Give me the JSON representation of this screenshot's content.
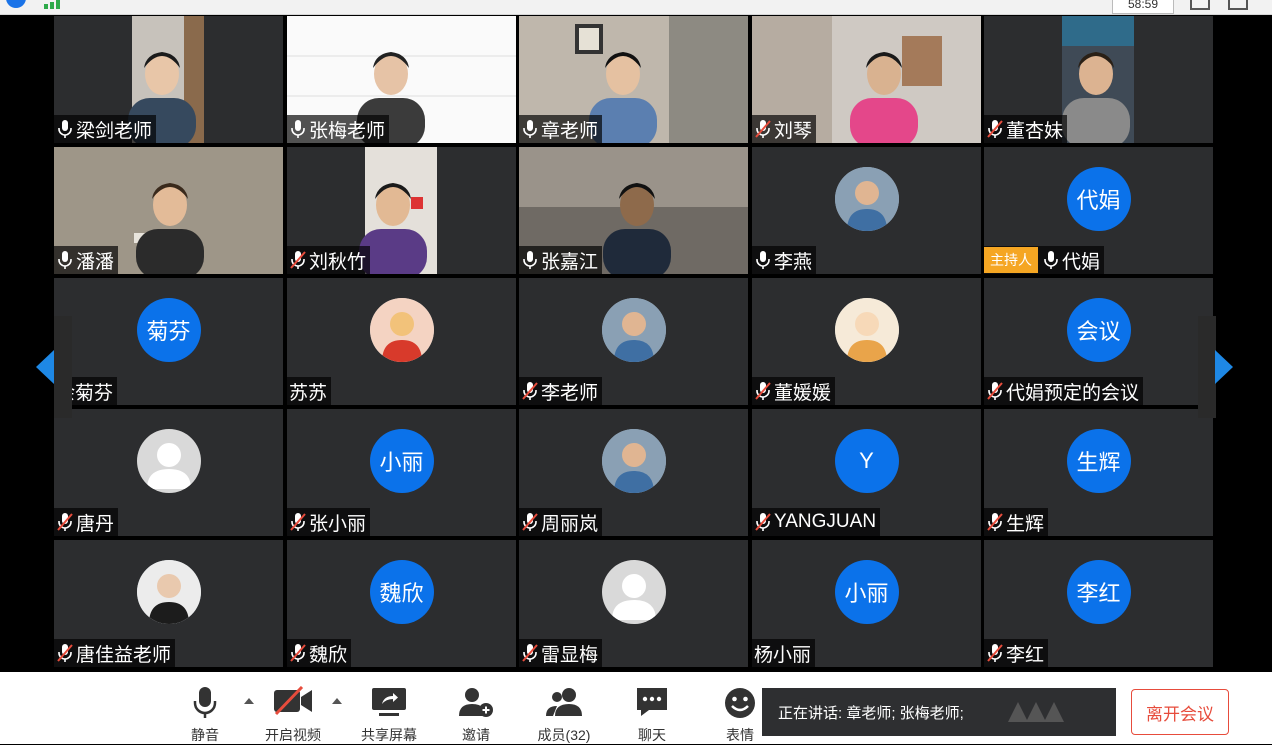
{
  "top": {
    "time": "58:59"
  },
  "tiles": [
    {
      "name": "梁剑老师",
      "mic": "on",
      "kind": "video",
      "scene": "man-window"
    },
    {
      "name": "张梅老师",
      "mic": "on",
      "kind": "video",
      "scene": "woman-glasses"
    },
    {
      "name": "章老师",
      "mic": "on",
      "kind": "video",
      "scene": "man-glasses"
    },
    {
      "name": "刘琴",
      "mic": "off",
      "kind": "video",
      "scene": "woman-room"
    },
    {
      "name": "董杏妹",
      "mic": "off",
      "kind": "video",
      "scene": "woman-shelf"
    },
    {
      "name": "潘潘",
      "mic": "on",
      "kind": "video",
      "scene": "woman-wall"
    },
    {
      "name": "刘秋竹",
      "mic": "off",
      "kind": "video",
      "scene": "child-purple"
    },
    {
      "name": "张嘉江",
      "mic": "on",
      "kind": "video",
      "scene": "man-dark"
    },
    {
      "name": "李燕",
      "mic": "on",
      "kind": "avatar",
      "avatar_type": "photo"
    },
    {
      "name": "代娟",
      "mic": "on",
      "kind": "avatar",
      "avatar_type": "text",
      "avatar_text": "代娟",
      "host": "主持人"
    },
    {
      "name": "余菊芬",
      "mic": "none",
      "kind": "avatar",
      "avatar_type": "text",
      "avatar_text": "菊芬"
    },
    {
      "name": "苏苏",
      "mic": "none",
      "kind": "avatar",
      "avatar_type": "photo-cartoon-red"
    },
    {
      "name": "李老师",
      "mic": "off",
      "kind": "avatar",
      "avatar_type": "photo"
    },
    {
      "name": "董媛媛",
      "mic": "off",
      "kind": "avatar",
      "avatar_type": "photo-cartoon-girl"
    },
    {
      "name": "代娟预定的会议",
      "mic": "off",
      "kind": "avatar",
      "avatar_type": "text",
      "avatar_text": "会议"
    },
    {
      "name": "唐丹",
      "mic": "off",
      "kind": "avatar",
      "avatar_type": "default"
    },
    {
      "name": "张小丽",
      "mic": "off",
      "kind": "avatar",
      "avatar_type": "text",
      "avatar_text": "小丽"
    },
    {
      "name": "周丽岚",
      "mic": "off",
      "kind": "avatar",
      "avatar_type": "photo"
    },
    {
      "name": "YANGJUAN",
      "mic": "off",
      "kind": "avatar",
      "avatar_type": "text",
      "avatar_text": "Y"
    },
    {
      "name": "生辉",
      "mic": "off",
      "kind": "avatar",
      "avatar_type": "text",
      "avatar_text": "生辉"
    },
    {
      "name": "唐佳益老师",
      "mic": "off",
      "kind": "avatar",
      "avatar_type": "photo-dark"
    },
    {
      "name": "魏欣",
      "mic": "off",
      "kind": "avatar",
      "avatar_type": "text",
      "avatar_text": "魏欣"
    },
    {
      "name": "雷显梅",
      "mic": "off",
      "kind": "avatar",
      "avatar_type": "default"
    },
    {
      "name": "杨小丽",
      "mic": "none",
      "kind": "avatar",
      "avatar_type": "text",
      "avatar_text": "小丽"
    },
    {
      "name": "李红",
      "mic": "off",
      "kind": "avatar",
      "avatar_type": "text",
      "avatar_text": "李红"
    }
  ],
  "toolbar": {
    "mute": "静音",
    "video": "开启视频",
    "share": "共享屏幕",
    "invite": "邀请",
    "members": "成员(32)",
    "chat": "聊天",
    "emoji": "表情"
  },
  "speaking": "正在讲话: 章老师; 张梅老师;",
  "leave": "离开会议",
  "colors": {
    "accent": "#0b72ea",
    "host": "#f5a623",
    "leave": "#e74c3c",
    "tile": "#2c2d2f"
  }
}
